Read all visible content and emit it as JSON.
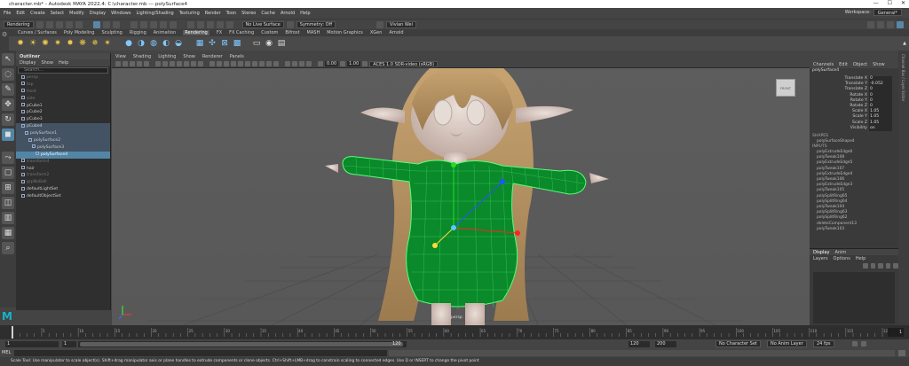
{
  "titlebar": {
    "title": "character.mb* - Autodesk MAYA 2022.4: C:\\character.mb  ---  polySurface4",
    "min": "—",
    "max": "☐",
    "close": "✕"
  },
  "menubar": {
    "items": [
      "File",
      "Edit",
      "Create",
      "Select",
      "Modify",
      "Display",
      "Windows",
      "Lighting/Shading",
      "Texturing",
      "Render",
      "Toon",
      "Stereo",
      "Cache",
      "Arnold",
      "Help"
    ],
    "workspace_label": "Workspace:",
    "workspace_value": "General*"
  },
  "statusline": {
    "mode": "Rendering",
    "live_surface": "No Live Surface",
    "symmetry": "Symmetry: Off",
    "sign_in": "Vivian Wei"
  },
  "shelf_tabs": [
    "Curves / Surfaces",
    "Poly Modeling",
    "Sculpting",
    "Rigging",
    "Animation",
    "Rendering",
    "FX",
    "FX Caching",
    "Custom",
    "Bifrost",
    "MASH",
    "Motion Graphics",
    "XGen",
    "Arnold"
  ],
  "shelf_active": "Rendering",
  "outliner": {
    "title": "Outliner",
    "menu": [
      "Display",
      "Show",
      "Help"
    ],
    "search_placeholder": "Search...",
    "items": [
      {
        "label": "persp",
        "dim": true
      },
      {
        "label": "top",
        "dim": true
      },
      {
        "label": "front",
        "dim": true
      },
      {
        "label": "side",
        "dim": true
      },
      {
        "label": "pCube1"
      },
      {
        "label": "pCube2"
      },
      {
        "label": "pCube3"
      },
      {
        "label": "pCube4",
        "sel2": true
      },
      {
        "label": "polySurface1",
        "sel2": true
      },
      {
        "label": "polySurface2",
        "sel2": true
      },
      {
        "label": "polySurface3",
        "sel2": true
      },
      {
        "label": "polySurface4",
        "sel": true
      },
      {
        "label": "transform4",
        "dim": true
      },
      {
        "label": "hair"
      },
      {
        "label": "transform2",
        "dim": true
      },
      {
        "label": "grpNoBall",
        "dim": true
      },
      {
        "label": "defaultLightSet"
      },
      {
        "label": "defaultObjectSet"
      }
    ]
  },
  "viewport": {
    "menu": [
      "View",
      "Shading",
      "Lighting",
      "Show",
      "Renderer",
      "Panels"
    ],
    "exposure": "0.00",
    "gamma": "1.00",
    "colorspace": "ACES 1.0 SDR-video (sRGB)",
    "camera_label": "persp",
    "viewcube_label": "FRONT"
  },
  "channelbox": {
    "tabs": [
      "Channel Box / Layer Editor"
    ],
    "menu": [
      "Channels",
      "Edit",
      "Object",
      "Show"
    ],
    "object": "polySurface4",
    "attrs": [
      {
        "label": "Translate X",
        "value": "0"
      },
      {
        "label": "Translate Y",
        "value": "-0.052"
      },
      {
        "label": "Translate Z",
        "value": "0"
      },
      {
        "label": "Rotate X",
        "value": "0"
      },
      {
        "label": "Rotate Y",
        "value": "0"
      },
      {
        "label": "Rotate Z",
        "value": "0"
      },
      {
        "label": "Scale X",
        "value": "1.05"
      },
      {
        "label": "Scale Y",
        "value": "1.05"
      },
      {
        "label": "Scale Z",
        "value": "1.05"
      },
      {
        "label": "Visibility",
        "value": "on"
      }
    ],
    "shapes_header": "SHAPES",
    "shape": "polySurfaceShape4",
    "inputs_header": "INPUTS",
    "inputs": [
      "polyExtrudeEdge6",
      "polyTweak108",
      "polyExtrudeEdge5",
      "polyTweak107",
      "polyExtrudeEdge4",
      "polyTweak106",
      "polyExtrudeEdge3",
      "polyTweak105",
      "polySplitRing65",
      "polySplitRing64",
      "polyTweak104",
      "polySplitRing63",
      "polySplitRing62",
      "deleteComponent13",
      "polyTweak103"
    ]
  },
  "layer": {
    "tabs": [
      "Display",
      "Anim"
    ],
    "menu": [
      "Layers",
      "Options",
      "Help"
    ]
  },
  "timeline": {
    "ticks": [
      "5",
      "10",
      "15",
      "20",
      "25",
      "30",
      "35",
      "40",
      "45",
      "50",
      "55",
      "60",
      "65",
      "70",
      "75",
      "80",
      "85",
      "90",
      "95",
      "100",
      "105",
      "110",
      "115",
      "120"
    ],
    "current_frame": "1"
  },
  "range": {
    "start": "1",
    "inner_start": "1",
    "inner_end": "120",
    "end": "120",
    "outer_end": "200",
    "fps": "24 fps",
    "char_set": "No Character Set",
    "anim_layer": "No Anim Layer"
  },
  "cmd": {
    "label": "MEL"
  },
  "helpline": {
    "text": "Scale Tool: Use manipulator to scale object(s). Shift+drag manipulator axis or plane handles to extrude components or clone objects. Ctrl+Shift+LMB+drag to constrain scaling to connected edges. Use D or INSERT to change the pivot point"
  },
  "colors": {
    "highlight": "#5285a6",
    "mesh_green": "#0a8a2a",
    "skin": "#d6c4bc",
    "hair": "#b38f5f"
  }
}
